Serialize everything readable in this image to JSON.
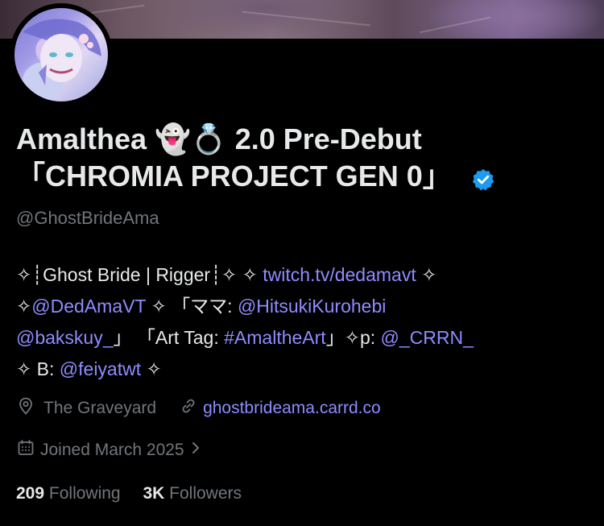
{
  "profile": {
    "display_name_line1": "Amalthea 👻💍 2.0 Pre-Debut",
    "display_name_line2": "「CHROMIA PROJECT GEN 0」",
    "handle": "@GhostBrideAma",
    "bio": {
      "line1_text": "✧┊Ghost Bride | Rigger┊✧ ✧ ",
      "line1_link": "twitch.tv/dedamavt",
      "line1_end": " ✧",
      "line2_start": "✧",
      "line2_link1": "@DedAmaVT",
      "line2_mid": " ✧ 「ママ: ",
      "line2_link2": "@HitsukiKurohebi",
      "line3_link1": "@bakskuy_",
      "line3_mid1": "」 「Art Tag: ",
      "line3_link2": "#AmaltheArt",
      "line3_mid2": "」✧p: ",
      "line3_link3": "@_CRRN_",
      "line4_start": "✧ B: ",
      "line4_link": "@feiyatwt",
      "line4_end": " ✧"
    },
    "location": "The Graveyard",
    "website": "ghostbrideama.carrd.co",
    "joined": "Joined March 2025",
    "following_count": "209",
    "following_label": "Following",
    "followers_count": "3K",
    "followers_label": "Followers"
  },
  "icons": {
    "location": "location-pin-icon",
    "link": "link-icon",
    "calendar": "calendar-icon",
    "chevron": "chevron-right-icon",
    "verified": "verified-badge-icon"
  },
  "colors": {
    "background": "#000000",
    "text": "#e7e9ea",
    "muted": "#71767b",
    "link": "#8e8cff",
    "verified": "#1d9bf0"
  }
}
